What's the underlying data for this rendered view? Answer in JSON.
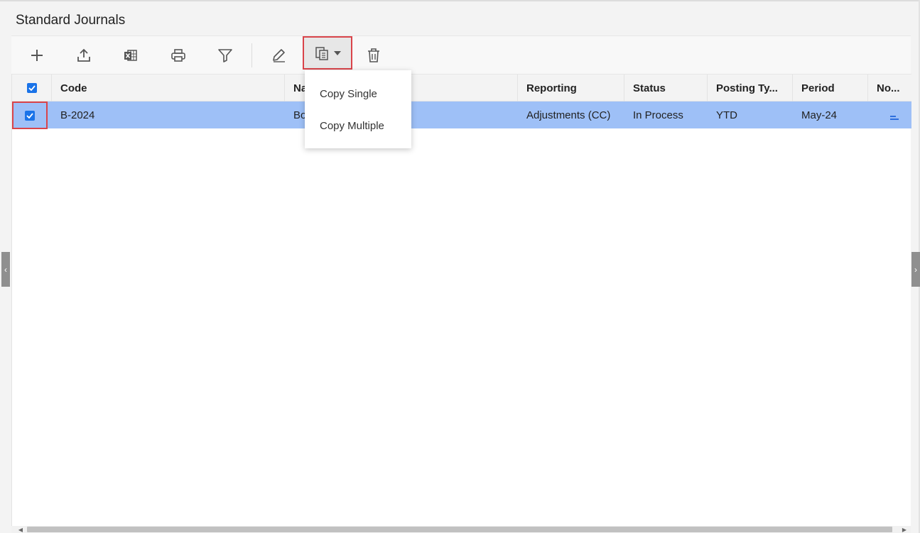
{
  "page": {
    "title": "Standard Journals"
  },
  "toolbar": {
    "buttons": [
      {
        "icon": "plus-icon"
      },
      {
        "icon": "upload-icon"
      },
      {
        "icon": "excel-icon"
      },
      {
        "icon": "print-icon"
      },
      {
        "icon": "filter-icon"
      },
      {
        "icon": "edit-icon"
      },
      {
        "icon": "copy-icon",
        "dropdown": true
      },
      {
        "icon": "trash-icon"
      }
    ]
  },
  "grid": {
    "columns": [
      "",
      "Code",
      "Na",
      "Reporting",
      "Status",
      "Posting Ty...",
      "Period",
      "No..."
    ],
    "rows": [
      {
        "selected": true,
        "code": "B-2024",
        "name": "Bo",
        "reporting": "Adjustments (CC)",
        "status": "In Process",
        "posting_type": "YTD",
        "period": "May-24",
        "notes_icon": "notes-icon"
      }
    ]
  },
  "copy_menu": {
    "items": [
      "Copy Single",
      "Copy Multiple"
    ]
  },
  "colors": {
    "accent": "#1a73e8",
    "selected_row": "#9ec0f7",
    "highlight_box": "#d9444a"
  }
}
